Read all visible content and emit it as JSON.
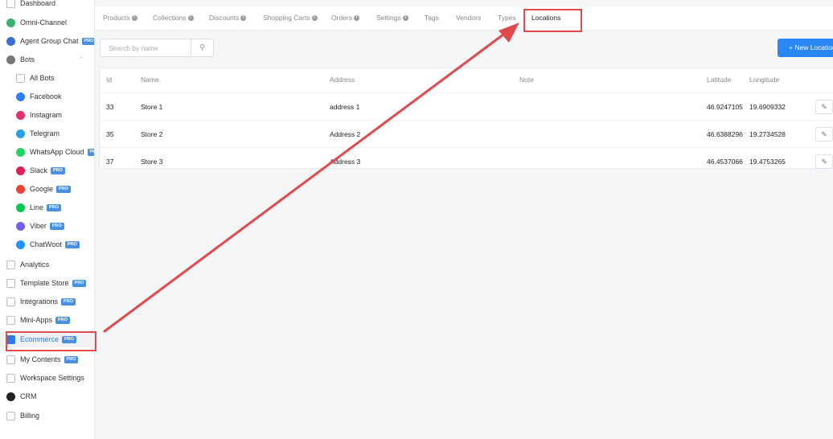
{
  "sidebar": {
    "items": [
      {
        "label": "Dashboard",
        "icon": "dashboard-icon",
        "color": "#b8bcc4",
        "pro": false
      },
      {
        "label": "Omni-Channel",
        "icon": "omni-channel-icon",
        "color": "#38b36f",
        "pro": false
      },
      {
        "label": "Agent Group Chat",
        "icon": "agent-group-icon",
        "color": "#3b6fd6",
        "pro": true
      },
      {
        "label": "Bots",
        "icon": "bots-icon",
        "color": "#777777",
        "pro": false
      },
      {
        "label": "All Bots",
        "icon": "all-bots-icon",
        "color": "#b8bcc4",
        "pro": false
      },
      {
        "label": "Facebook",
        "icon": "facebook-messenger-icon",
        "color": "#2d7ff9",
        "pro": false
      },
      {
        "label": "Instagram",
        "icon": "instagram-icon",
        "color": "#e1306c",
        "pro": false
      },
      {
        "label": "Telegram",
        "icon": "telegram-icon",
        "color": "#2aa0e0",
        "pro": false
      },
      {
        "label": "WhatsApp Cloud",
        "icon": "whatsapp-icon",
        "color": "#25d366",
        "pro": true
      },
      {
        "label": "Slack",
        "icon": "slack-icon",
        "color": "#e01e5a",
        "pro": true
      },
      {
        "label": "Google",
        "icon": "google-icon",
        "color": "#ea4335",
        "pro": true
      },
      {
        "label": "Line",
        "icon": "line-icon",
        "color": "#06c755",
        "pro": true
      },
      {
        "label": "Viber",
        "icon": "viber-icon",
        "color": "#7360f2",
        "pro": true
      },
      {
        "label": "ChatWoot",
        "icon": "chatwoot-icon",
        "color": "#1f93ff",
        "pro": true
      },
      {
        "label": "Analytics",
        "icon": "analytics-icon",
        "color": "#b8bcc4",
        "pro": false
      },
      {
        "label": "Template Store",
        "icon": "template-store-icon",
        "color": "#b8bcc4",
        "pro": true
      },
      {
        "label": "Integrations",
        "icon": "integrations-icon",
        "color": "#b8bcc4",
        "pro": true
      },
      {
        "label": "Mini-Apps",
        "icon": "mini-apps-icon",
        "color": "#b8bcc4",
        "pro": true
      },
      {
        "label": "Ecommerce",
        "icon": "ecommerce-icon",
        "color": "#2a7ee8",
        "pro": true
      },
      {
        "label": "My Contents",
        "icon": "my-contents-icon",
        "color": "#b8bcc4",
        "pro": true
      },
      {
        "label": "Workspace Settings",
        "icon": "workspace-settings-icon",
        "color": "#b8bcc4",
        "pro": false
      },
      {
        "label": "CRM",
        "icon": "crm-icon",
        "color": "#222222",
        "pro": false
      },
      {
        "label": "Billing",
        "icon": "billing-icon",
        "color": "#b8bcc4",
        "pro": false
      }
    ],
    "pro_badge": "PRO"
  },
  "tabs": [
    {
      "label": "Products",
      "info": true
    },
    {
      "label": "Collections",
      "info": true
    },
    {
      "label": "Discounts",
      "info": true
    },
    {
      "label": "Shopping Carts",
      "info": true
    },
    {
      "label": "Orders",
      "info": true
    },
    {
      "label": "Settings",
      "info": true
    },
    {
      "label": "Tags",
      "info": false
    },
    {
      "label": "Vendors",
      "info": false
    },
    {
      "label": "Types",
      "info": false
    },
    {
      "label": "Locations",
      "info": false
    }
  ],
  "info_glyph": "i",
  "search": {
    "placeholder": "Search by name"
  },
  "new_button": "+ New Location",
  "table": {
    "columns": {
      "id": "Id",
      "name": "Name",
      "address": "Address",
      "note": "Note",
      "latitude": "Latitude",
      "longitude": "Longitude"
    },
    "rows": [
      {
        "id": "33",
        "name": "Store 1",
        "address": "address 1",
        "note": "",
        "latitude": "46.9247105",
        "longitude": "19.6909332"
      },
      {
        "id": "35",
        "name": "Store 2",
        "address": "Address 2",
        "note": "",
        "latitude": "46.6388296",
        "longitude": "19.2734528"
      },
      {
        "id": "37",
        "name": "Store 3",
        "address": "Address 3",
        "note": "",
        "latitude": "46.4537066",
        "longitude": "19.4753265"
      }
    ]
  },
  "colors": {
    "accent": "#2b87f3",
    "annotation": "#e04a4a"
  }
}
